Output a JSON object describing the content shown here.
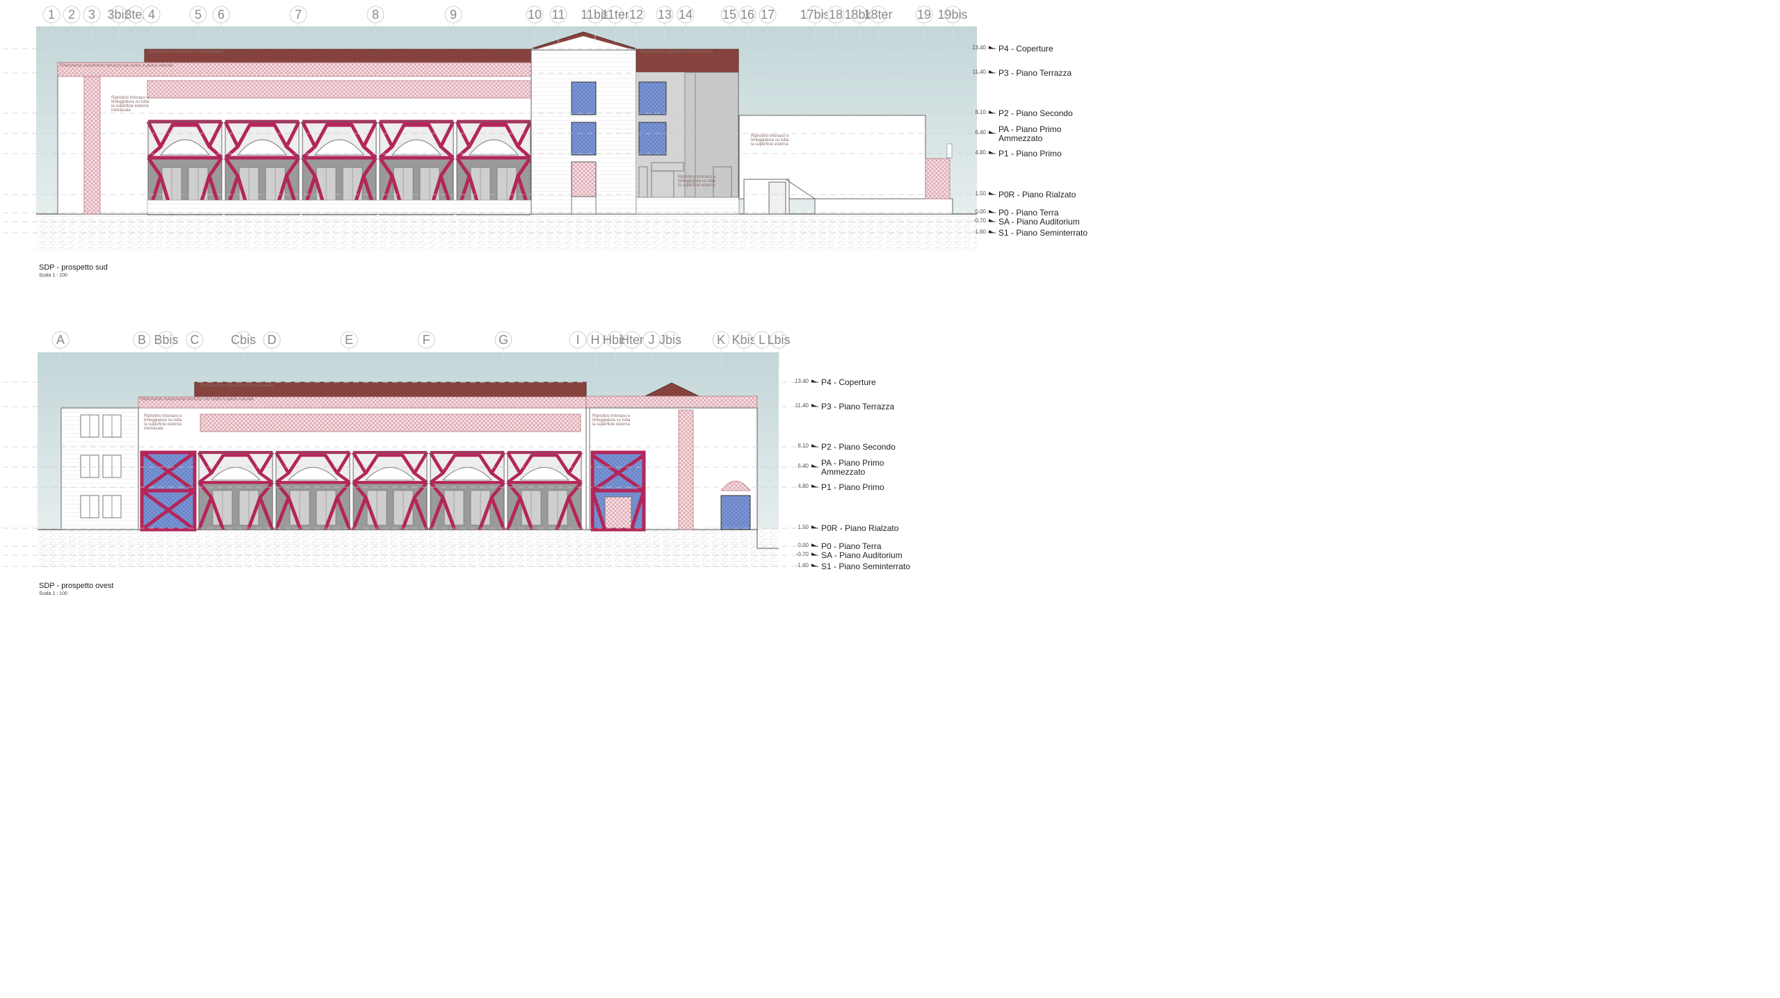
{
  "colors": {
    "sky": "#c9dadb",
    "roof": "#7d3b36",
    "brace": "#b3265a",
    "glass": "#6a86c9",
    "dark_wall": "#8c8c8c",
    "light_wall": "#f2f2f2",
    "hatch_pink": "#e9b8bf",
    "grid_circle": "#cfcfcf"
  },
  "levels": [
    {
      "name": "P4 - Coperture",
      "elev": "13.40"
    },
    {
      "name": "P3 - Piano Terrazza",
      "elev": "11.40"
    },
    {
      "name": "P2 - Piano Secondo",
      "elev": "8.10"
    },
    {
      "name": "PA - Piano Primo Ammezzato",
      "line1": "PA - Piano Primo",
      "line2": "Ammezzato",
      "elev": "6.40"
    },
    {
      "name": "P1 - Piano Primo",
      "elev": "4.80"
    },
    {
      "name": "P0R - Piano Rialzato",
      "elev": "1.50"
    },
    {
      "name": "P0 - Piano Terra",
      "elev": "0.00"
    },
    {
      "name": "SA - Piano Auditorium",
      "elev": "-0.70"
    },
    {
      "name": "S1 - Piano Seminterrato",
      "elev": "-1.60"
    }
  ],
  "views": [
    {
      "title": "SDP - prospetto sud",
      "scale": "Scala    1 : 100",
      "grid": [
        "1",
        "2",
        "3",
        "3bis",
        "3ter",
        "4",
        "5",
        "6",
        "7",
        "8",
        "9",
        "10",
        "11",
        "11bis",
        "11ter",
        "12",
        "13",
        "14",
        "15",
        "16",
        "17",
        "17bis",
        "18",
        "18bis",
        "18ter",
        "19",
        "19bis"
      ]
    },
    {
      "title": "SDP - prospetto ovest",
      "scale": "Scala    1 : 100",
      "grid": [
        "A",
        "B",
        "Bbis",
        "C",
        "Cbis",
        "D",
        "E",
        "F",
        "G",
        "I",
        "H",
        "Hbis",
        "Hter",
        "J",
        "Jbis",
        "K",
        "Kbis",
        "L",
        "Lbis"
      ]
    }
  ]
}
